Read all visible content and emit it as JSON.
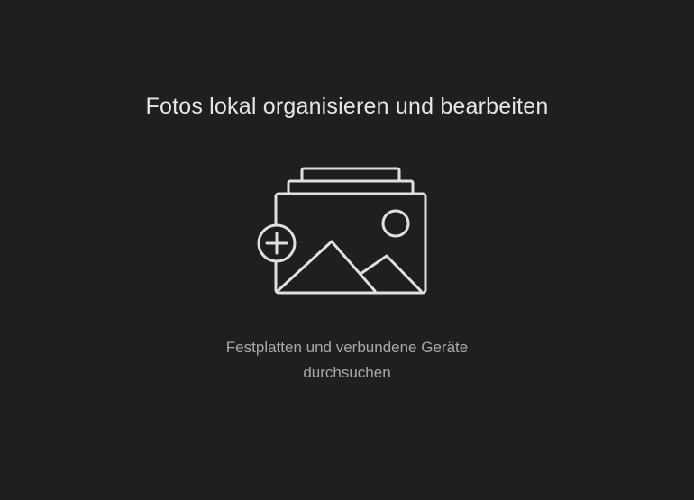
{
  "empty_state": {
    "title": "Fotos lokal organisieren und bearbeiten",
    "illustration_icon": "add-photos-icon",
    "action": {
      "line1": "Festplatten und verbundene Geräte",
      "line2": "durchsuchen"
    }
  },
  "colors": {
    "background": "#1f1f1f",
    "title_text": "#e6e6e6",
    "action_text": "#a8a8a8",
    "icon_stroke": "#e0e0e0"
  }
}
